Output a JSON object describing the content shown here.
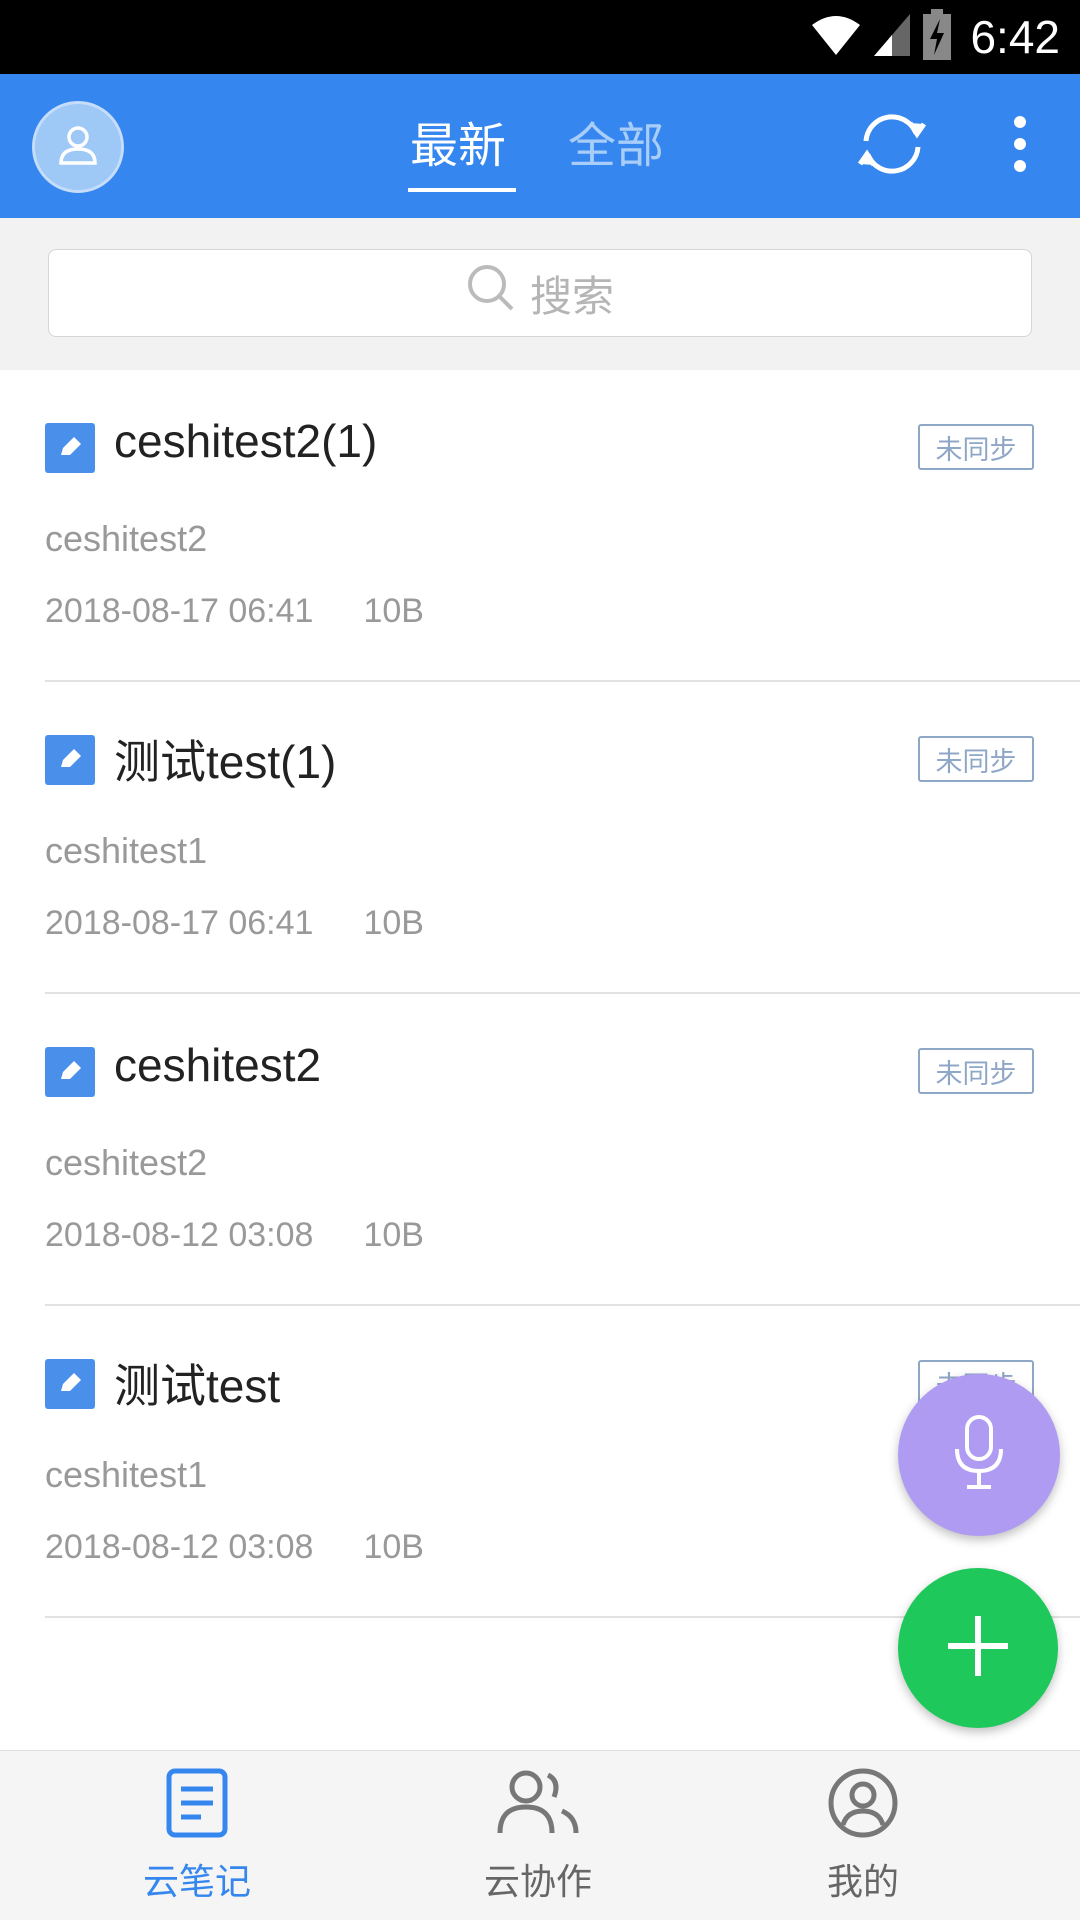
{
  "status_bar": {
    "time": "6:42",
    "icons": [
      "wifi-icon",
      "signal-icon",
      "battery-charging-icon"
    ]
  },
  "header": {
    "tabs": [
      {
        "label": "最新",
        "active": true
      },
      {
        "label": "全部",
        "active": false
      }
    ],
    "icons": [
      "avatar-icon",
      "sync-icon",
      "more-vert-icon"
    ],
    "accent_color": "#3586ee"
  },
  "search": {
    "placeholder": "搜索"
  },
  "notes": [
    {
      "title": "ceshitest2(1)",
      "badge": "未同步",
      "preview": "ceshitest2",
      "date": "2018-08-17 06:41",
      "size": "10B"
    },
    {
      "title": "测试test(1)",
      "badge": "未同步",
      "preview": "ceshitest1",
      "date": "2018-08-17 06:41",
      "size": "10B"
    },
    {
      "title": "ceshitest2",
      "badge": "未同步",
      "preview": "ceshitest2",
      "date": "2018-08-12 03:08",
      "size": "10B"
    },
    {
      "title": "测试test",
      "badge": "未同步",
      "preview": "ceshitest1",
      "date": "2018-08-12 03:08",
      "size": "10B"
    }
  ],
  "fabs": {
    "mic_color": "#b09bf2",
    "add_color": "#1ec85a"
  },
  "bottom_nav": [
    {
      "label": "云笔记",
      "icon": "notes-icon",
      "active": true
    },
    {
      "label": "云协作",
      "icon": "people-icon",
      "active": false
    },
    {
      "label": "我的",
      "icon": "profile-icon",
      "active": false
    }
  ]
}
